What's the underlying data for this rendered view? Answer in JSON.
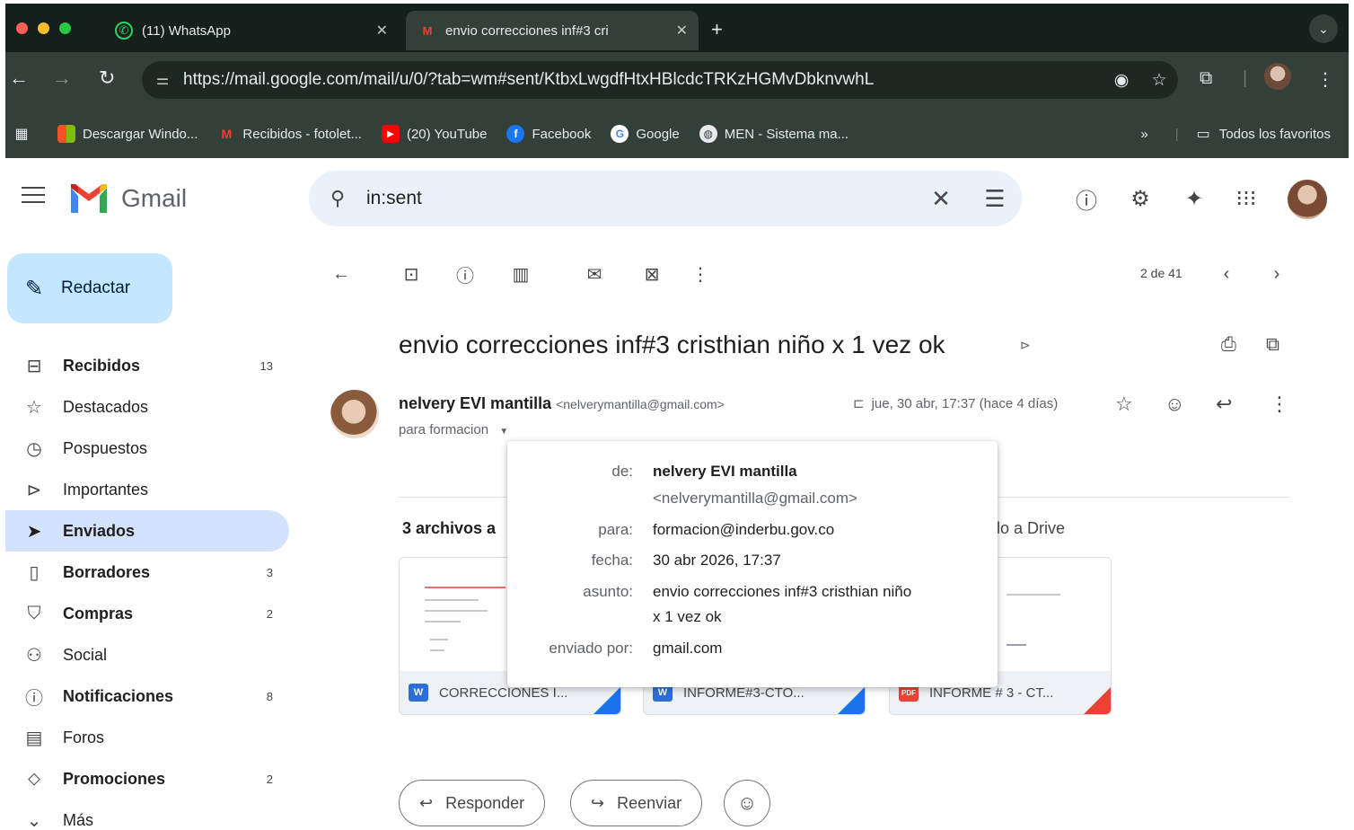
{
  "browser": {
    "tabs": [
      {
        "title": "(11) WhatsApp",
        "icon": "whatsapp-icon"
      },
      {
        "title": "envio correcciones inf#3 cri",
        "icon": "gmail-icon"
      }
    ],
    "new_tab": "+",
    "url": "https://mail.google.com/mail/u/0/?tab=wm#sent/KtbxLwgdfHtxHBlcdcTRKzHGMvDbknvwhL",
    "bookmarks": [
      {
        "label": "Descargar Windo...",
        "icon": "windows-icon",
        "color": "#f35325"
      },
      {
        "label": "Recibidos - fotolet...",
        "icon": "gmail-icon",
        "color": "#ea4335"
      },
      {
        "label": "(20) YouTube",
        "icon": "youtube-icon",
        "color": "#ff0000"
      },
      {
        "label": "Facebook",
        "icon": "facebook-icon",
        "color": "#1877f2"
      },
      {
        "label": "Google",
        "icon": "google-icon",
        "color": "#4285f4"
      },
      {
        "label": "MEN - Sistema ma...",
        "icon": "globe-icon",
        "color": "#9aa0a6"
      }
    ],
    "overflow": "»",
    "all_bookmarks": "Todos los favoritos"
  },
  "gmail": {
    "brand": "Gmail",
    "search_value": "in:sent",
    "compose": "Redactar",
    "nav": [
      {
        "label": "Recibidos",
        "count": "13",
        "icon": "inbox-icon",
        "bold": true
      },
      {
        "label": "Destacados",
        "count": "",
        "icon": "star-icon",
        "bold": false
      },
      {
        "label": "Pospuestos",
        "count": "",
        "icon": "clock-icon",
        "bold": false
      },
      {
        "label": "Importantes",
        "count": "",
        "icon": "important-icon",
        "bold": false
      },
      {
        "label": "Enviados",
        "count": "",
        "icon": "send-icon",
        "bold": true
      },
      {
        "label": "Borradores",
        "count": "3",
        "icon": "draft-icon",
        "bold": true
      },
      {
        "label": "Compras",
        "count": "2",
        "icon": "shopping-icon",
        "bold": true
      },
      {
        "label": "Social",
        "count": "",
        "icon": "social-icon",
        "bold": false
      },
      {
        "label": "Notificaciones",
        "count": "8",
        "icon": "info-icon",
        "bold": true
      },
      {
        "label": "Foros",
        "count": "",
        "icon": "forum-icon",
        "bold": false
      },
      {
        "label": "Promociones",
        "count": "2",
        "icon": "tag-icon",
        "bold": true
      },
      {
        "label": "Más",
        "count": "",
        "icon": "chevron-down-icon",
        "bold": false
      }
    ],
    "pager": "2 de 41"
  },
  "message": {
    "subject": "envio correcciones inf#3 cristhian niño x 1 vez ok",
    "sender_name": "nelvery EVI mantilla",
    "sender_email": "<nelverymantilla@gmail.com>",
    "to": "para formacion",
    "date": "jue, 30 abr, 17:37 (hace 4 días)",
    "attachments_title": "3 archivos a",
    "save_drive": "lo a Drive",
    "attachments": [
      {
        "name": "CORRECCIONES I...",
        "type": "W",
        "color": "#2b6fd6",
        "corner": "#1a73e8"
      },
      {
        "name": "INFORME#3-CTO...",
        "type": "W",
        "color": "#2b6fd6",
        "corner": "#1a73e8"
      },
      {
        "name": "INFORME # 3 - CT...",
        "type": "PDF",
        "color": "#ea4335",
        "corner": "#ea4335"
      }
    ]
  },
  "details": {
    "de_label": "de:",
    "de_name": "nelvery EVI mantilla",
    "de_email": "<nelverymantilla@gmail.com>",
    "para_label": "para:",
    "para_value": "formacion@inderbu.gov.co",
    "fecha_label": "fecha:",
    "fecha_value": "30 abr 2026, 17:37",
    "asunto_label": "asunto:",
    "asunto_line1": "envio correcciones inf#3 cristhian niño",
    "asunto_line2": "x 1 vez ok",
    "enviado_label": "enviado por:",
    "enviado_value": "gmail.com"
  },
  "actions": {
    "reply": "Responder",
    "forward": "Reenviar"
  }
}
